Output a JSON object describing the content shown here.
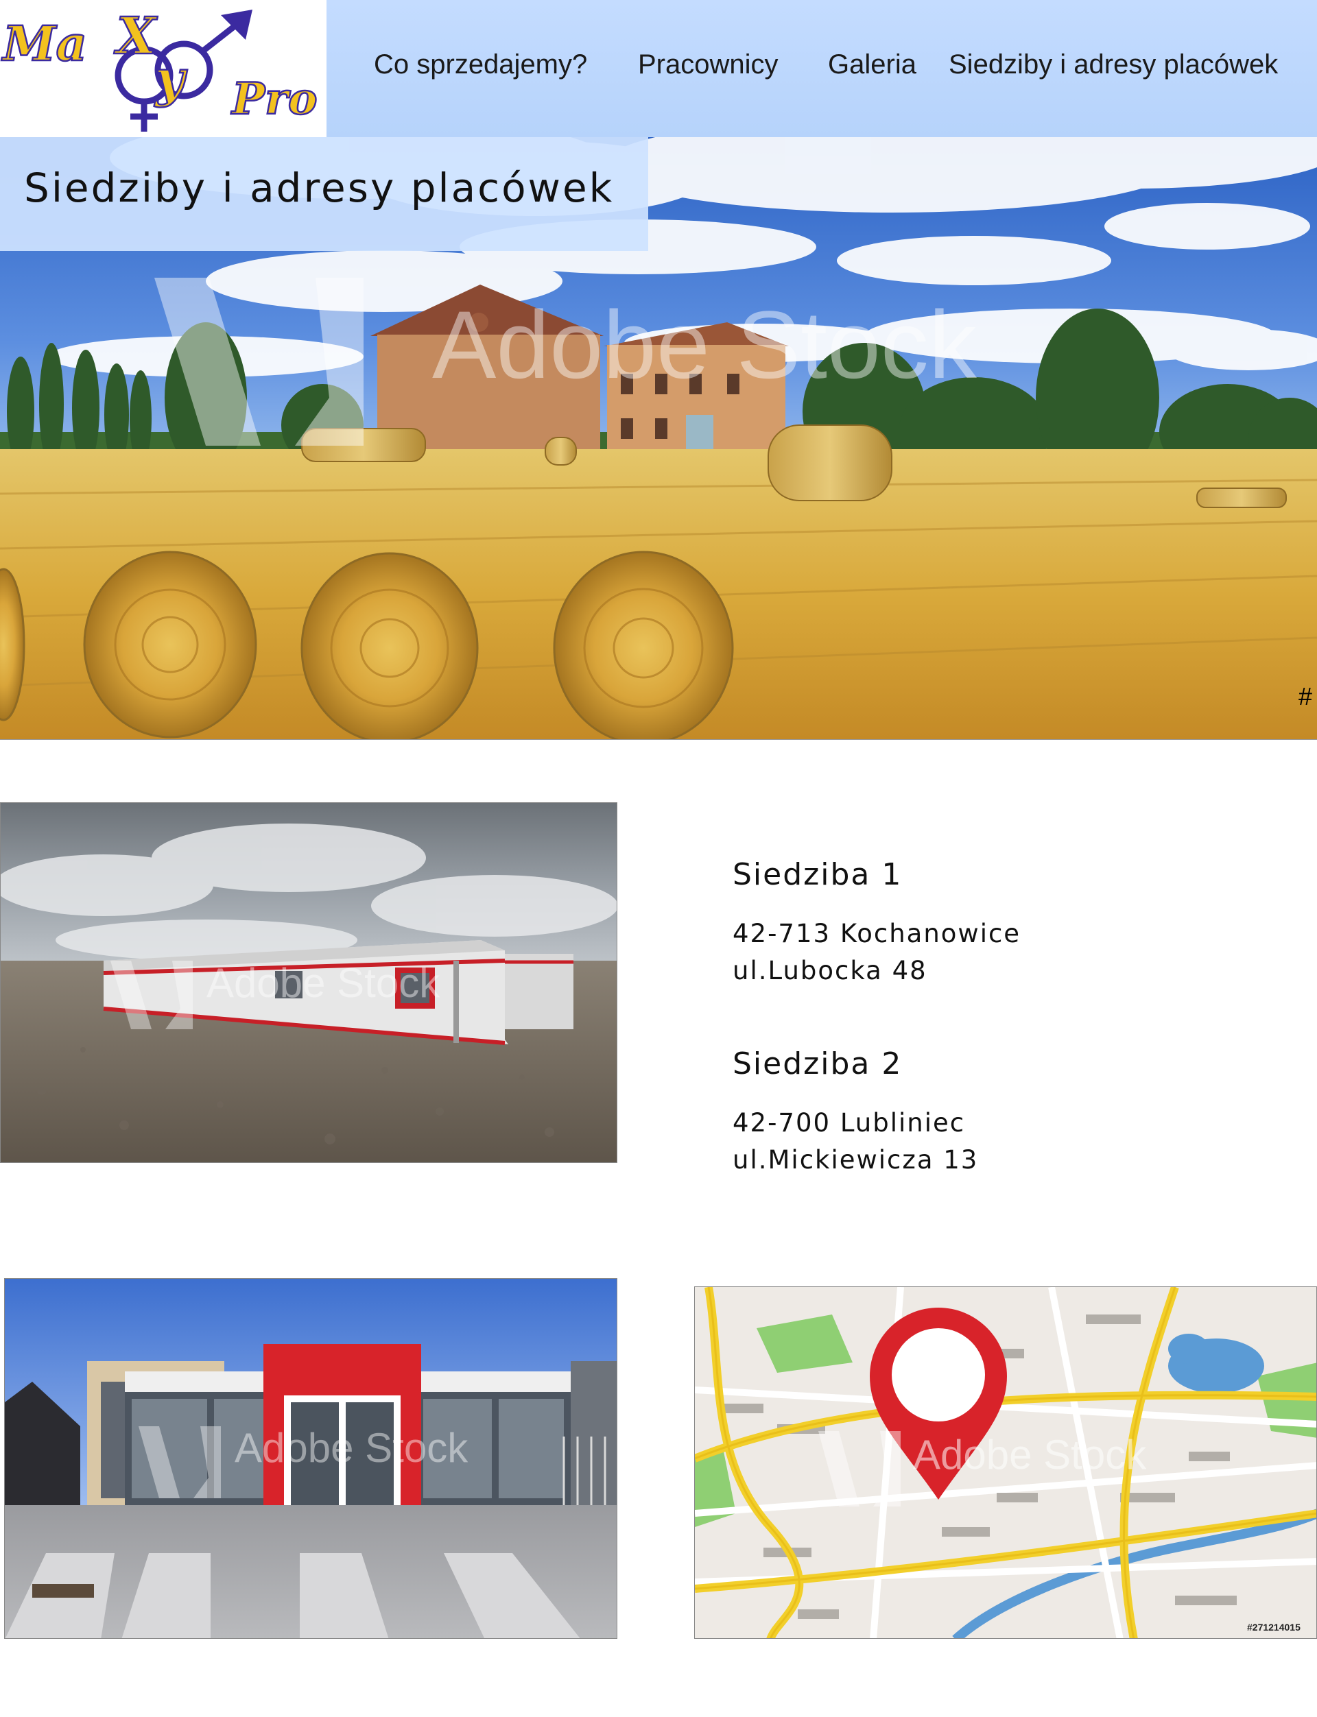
{
  "logo": {
    "brand_text": "MaXyPro",
    "colors": {
      "yellow": "#f3c21e",
      "purple": "#3b2aa0"
    }
  },
  "nav": {
    "items": [
      {
        "label": "Co sprzedajemy?"
      },
      {
        "label": "Pracownicy"
      },
      {
        "label": "Galeria"
      },
      {
        "label": "Siedziby i adresy placówek"
      }
    ]
  },
  "hero": {
    "title": "Siedziby i adresy placówek",
    "watermark": "Adobe Stock",
    "corner_mark": "#"
  },
  "locations": [
    {
      "heading": "Siedziba 1",
      "line1": "42-713 Kochanowice",
      "line2": "ul.Lubocka 48"
    },
    {
      "heading": "Siedziba 2",
      "line1": "42-700 Lubliniec",
      "line2": "ul.Mickiewicza 13"
    }
  ],
  "photos": {
    "watermark": "Adobe Stock",
    "map_stock_id": "#271214015"
  },
  "colors": {
    "header_bg": "#bcd6fd",
    "accent_red": "#d8232a",
    "map_road_yellow": "#f2cf2a"
  }
}
